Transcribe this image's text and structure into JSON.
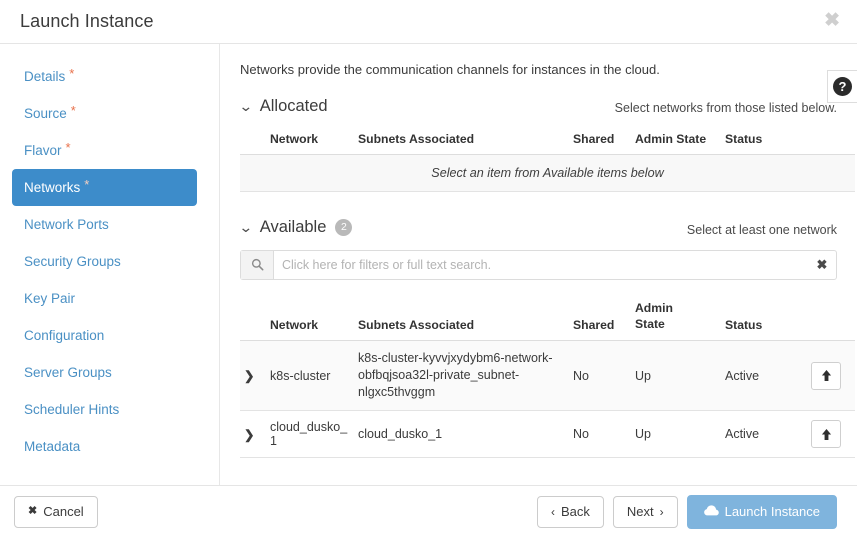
{
  "dialog": {
    "title": "Launch Instance",
    "close_label": "✖",
    "help_label": "?"
  },
  "sidebar": {
    "items": [
      {
        "label": "Details",
        "required": true,
        "active": false,
        "name": "details"
      },
      {
        "label": "Source",
        "required": true,
        "active": false,
        "name": "source"
      },
      {
        "label": "Flavor",
        "required": true,
        "active": false,
        "name": "flavor"
      },
      {
        "label": "Networks",
        "required": true,
        "active": true,
        "name": "networks"
      },
      {
        "label": "Network Ports",
        "required": false,
        "active": false,
        "name": "network-ports"
      },
      {
        "label": "Security Groups",
        "required": false,
        "active": false,
        "name": "security-groups"
      },
      {
        "label": "Key Pair",
        "required": false,
        "active": false,
        "name": "key-pair"
      },
      {
        "label": "Configuration",
        "required": false,
        "active": false,
        "name": "configuration"
      },
      {
        "label": "Server Groups",
        "required": false,
        "active": false,
        "name": "server-groups"
      },
      {
        "label": "Scheduler Hints",
        "required": false,
        "active": false,
        "name": "scheduler-hints"
      },
      {
        "label": "Metadata",
        "required": false,
        "active": false,
        "name": "metadata"
      }
    ],
    "required_marker": "*"
  },
  "main": {
    "intro": "Networks provide the communication channels for instances in the cloud.",
    "allocated": {
      "title": "Allocated",
      "caret": "⌄",
      "note": "Select networks from those listed below.",
      "columns": [
        "Network",
        "Subnets Associated",
        "Shared",
        "Admin State",
        "Status"
      ],
      "empty_message": "Select an item from Available items below"
    },
    "available": {
      "title": "Available",
      "caret": "⌄",
      "count": "2",
      "note": "Select at least one network",
      "search": {
        "placeholder": "Click here for filters or full text search.",
        "value": "",
        "clear_label": "✖",
        "icon": "search-icon"
      },
      "columns": [
        "Network",
        "Subnets Associated",
        "Shared",
        "Admin State",
        "Status"
      ],
      "admin_state_line1": "Admin",
      "admin_state_line2": "State",
      "rows": [
        {
          "expand": "❯",
          "network": "k8s-cluster",
          "subnets": "k8s-cluster-kyvvjxydybm6-network-obfbqjsoa32l-private_subnet-nlgxc5thvggm",
          "shared": "No",
          "admin_state": "Up",
          "status": "Active",
          "action": "add-to-allocated"
        },
        {
          "expand": "❯",
          "network": "cloud_dusko_1",
          "subnets": "cloud_dusko_1",
          "shared": "No",
          "admin_state": "Up",
          "status": "Active",
          "action": "add-to-allocated"
        }
      ]
    }
  },
  "footer": {
    "cancel": "Cancel",
    "cancel_icon": "✖",
    "back": "Back",
    "back_icon": "‹",
    "next": "Next",
    "next_icon": "›",
    "launch": "Launch Instance",
    "launch_icon": "cloud-icon"
  },
  "colors": {
    "accent": "#3d8cca",
    "link": "#4a90c4",
    "primary_button": "#7fb4dd",
    "required_marker": "#e8704a",
    "badge": "#b9b9b9"
  }
}
